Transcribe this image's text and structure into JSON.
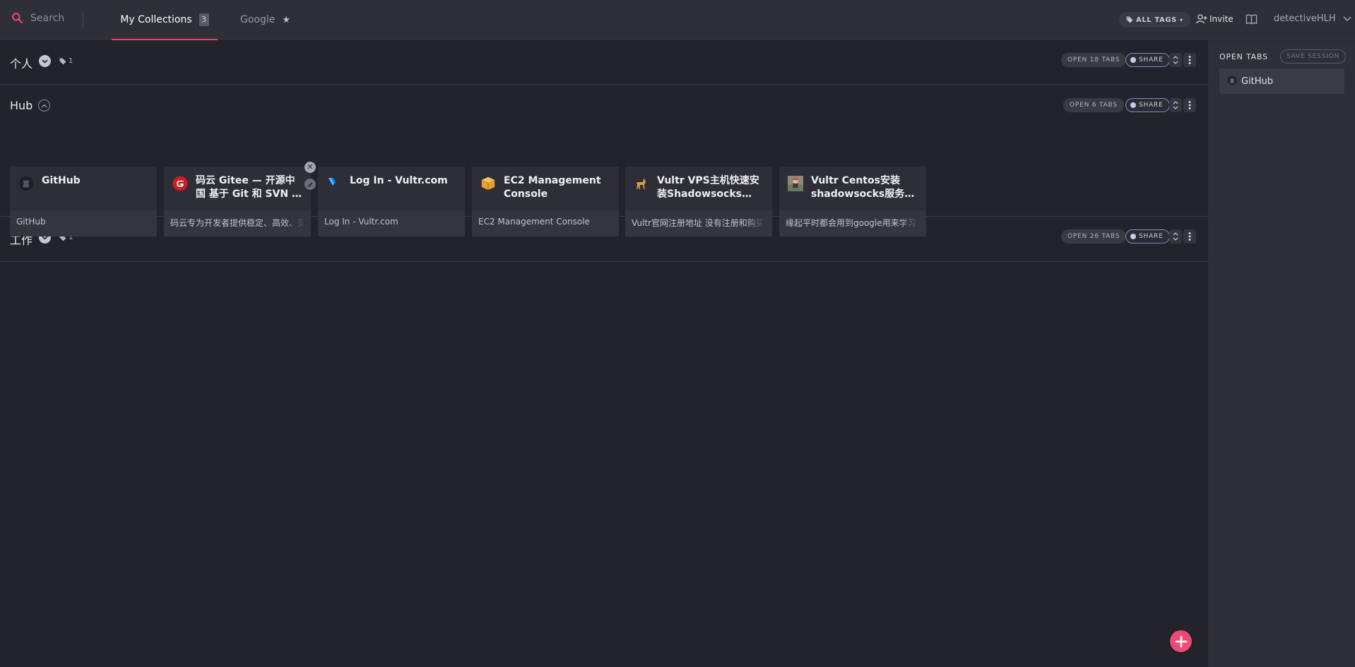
{
  "topbar": {
    "search_label": "Search",
    "tabs": [
      {
        "label": "My Collections",
        "count": "3"
      },
      {
        "label": "Google"
      }
    ],
    "all_tags_label": "ALL TAGS",
    "invite_label": "Invite",
    "username": "detectiveHLH"
  },
  "collections": [
    {
      "title": "个人",
      "tag_count": "1",
      "open_tabs_label": "OPEN 18 TABS",
      "share_label": "SHARE"
    },
    {
      "title": "Hub",
      "open_tabs_label": "OPEN 6 TABS",
      "share_label": "SHARE",
      "cards": [
        {
          "title": "GitHub",
          "desc": "GitHub",
          "icon": "github-icon"
        },
        {
          "title": "码云 Gitee — 开源中国 基于 Git 和 SVN 的代码托管和协作开发平台",
          "desc": "码云专为开发者提供稳定、高效、安全的云端软件开发协作平台",
          "icon": "gitee-icon"
        },
        {
          "title": "Log In - Vultr.com",
          "desc": "Log In - Vultr.com",
          "icon": "vultr-icon"
        },
        {
          "title": "EC2 Management Console",
          "desc": "EC2 Management Console",
          "icon": "aws-box-icon"
        },
        {
          "title": "Vultr VPS主机快速安装Shadowsocks（ss）服务器",
          "desc": "Vultr官网注册地址 没有注册和购买",
          "icon": "deer-icon"
        },
        {
          "title": "Vultr Centos安装shadowsocks服务端教程",
          "desc": "缘起平时都会用到google用来学习",
          "icon": "avatar-image-icon"
        }
      ]
    },
    {
      "title": "工作",
      "tag_count": "1",
      "open_tabs_label": "OPEN 26 TABS",
      "share_label": "SHARE"
    }
  ],
  "sidebar": {
    "title": "OPEN TABS",
    "save_session_label": "SAVE SESSION",
    "tabs": [
      {
        "label": "GitHub",
        "icon": "github-icon"
      }
    ]
  },
  "colors": {
    "accent": "#e8456b",
    "fab": "#ef4a75",
    "background": "#23232b",
    "topbar": "#2e2f37"
  }
}
